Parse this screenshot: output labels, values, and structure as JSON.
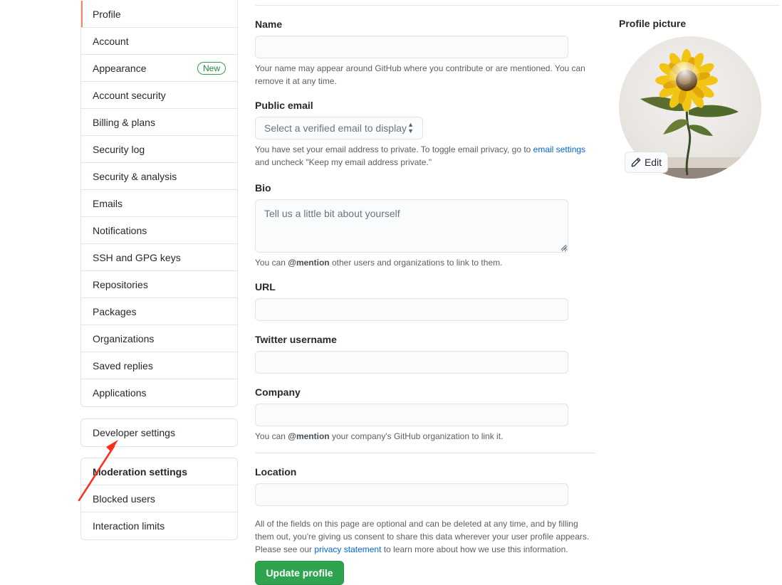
{
  "sidebar": {
    "main_items": [
      {
        "label": "Profile",
        "selected": true
      },
      {
        "label": "Account"
      },
      {
        "label": "Appearance",
        "badge": "New"
      },
      {
        "label": "Account security"
      },
      {
        "label": "Billing & plans"
      },
      {
        "label": "Security log"
      },
      {
        "label": "Security & analysis"
      },
      {
        "label": "Emails"
      },
      {
        "label": "Notifications"
      },
      {
        "label": "SSH and GPG keys"
      },
      {
        "label": "Repositories"
      },
      {
        "label": "Packages"
      },
      {
        "label": "Organizations"
      },
      {
        "label": "Saved replies"
      },
      {
        "label": "Applications"
      }
    ],
    "developer": {
      "label": "Developer settings"
    },
    "moderation": {
      "heading": "Moderation settings",
      "items": [
        {
          "label": "Blocked users"
        },
        {
          "label": "Interaction limits"
        }
      ]
    }
  },
  "form": {
    "name": {
      "label": "Name",
      "value": "",
      "note": "Your name may appear around GitHub where you contribute or are mentioned. You can remove it at any time."
    },
    "public_email": {
      "label": "Public email",
      "selected": "Select a verified email to display",
      "note_before": "You have set your email address to private. To toggle email privacy, go to ",
      "note_link": "email settings",
      "note_after": " and uncheck \"Keep my email address private.\""
    },
    "bio": {
      "label": "Bio",
      "placeholder": "Tell us a little bit about yourself",
      "note_before": "You can ",
      "note_bold": "@mention",
      "note_after": " other users and organizations to link to them."
    },
    "url": {
      "label": "URL",
      "value": ""
    },
    "twitter": {
      "label": "Twitter username",
      "value": ""
    },
    "company": {
      "label": "Company",
      "value": "",
      "note_before": "You can ",
      "note_bold": "@mention",
      "note_after": " your company's GitHub organization to link it."
    },
    "location": {
      "label": "Location",
      "value": ""
    },
    "footer": {
      "text_before": "All of the fields on this page are optional and can be deleted at any time, and by filling them out, you're giving us consent to share this data wherever your user profile appears. Please see our ",
      "link": "privacy statement",
      "text_after": " to learn more about how we use this information."
    },
    "submit_label": "Update profile"
  },
  "profile_picture": {
    "label": "Profile picture",
    "edit_label": "Edit"
  },
  "colors": {
    "selected_marker": "#f9826c",
    "primary_button": "#2ea44f",
    "link": "#0366d6",
    "annotation_arrow": "#ff2a1a"
  }
}
